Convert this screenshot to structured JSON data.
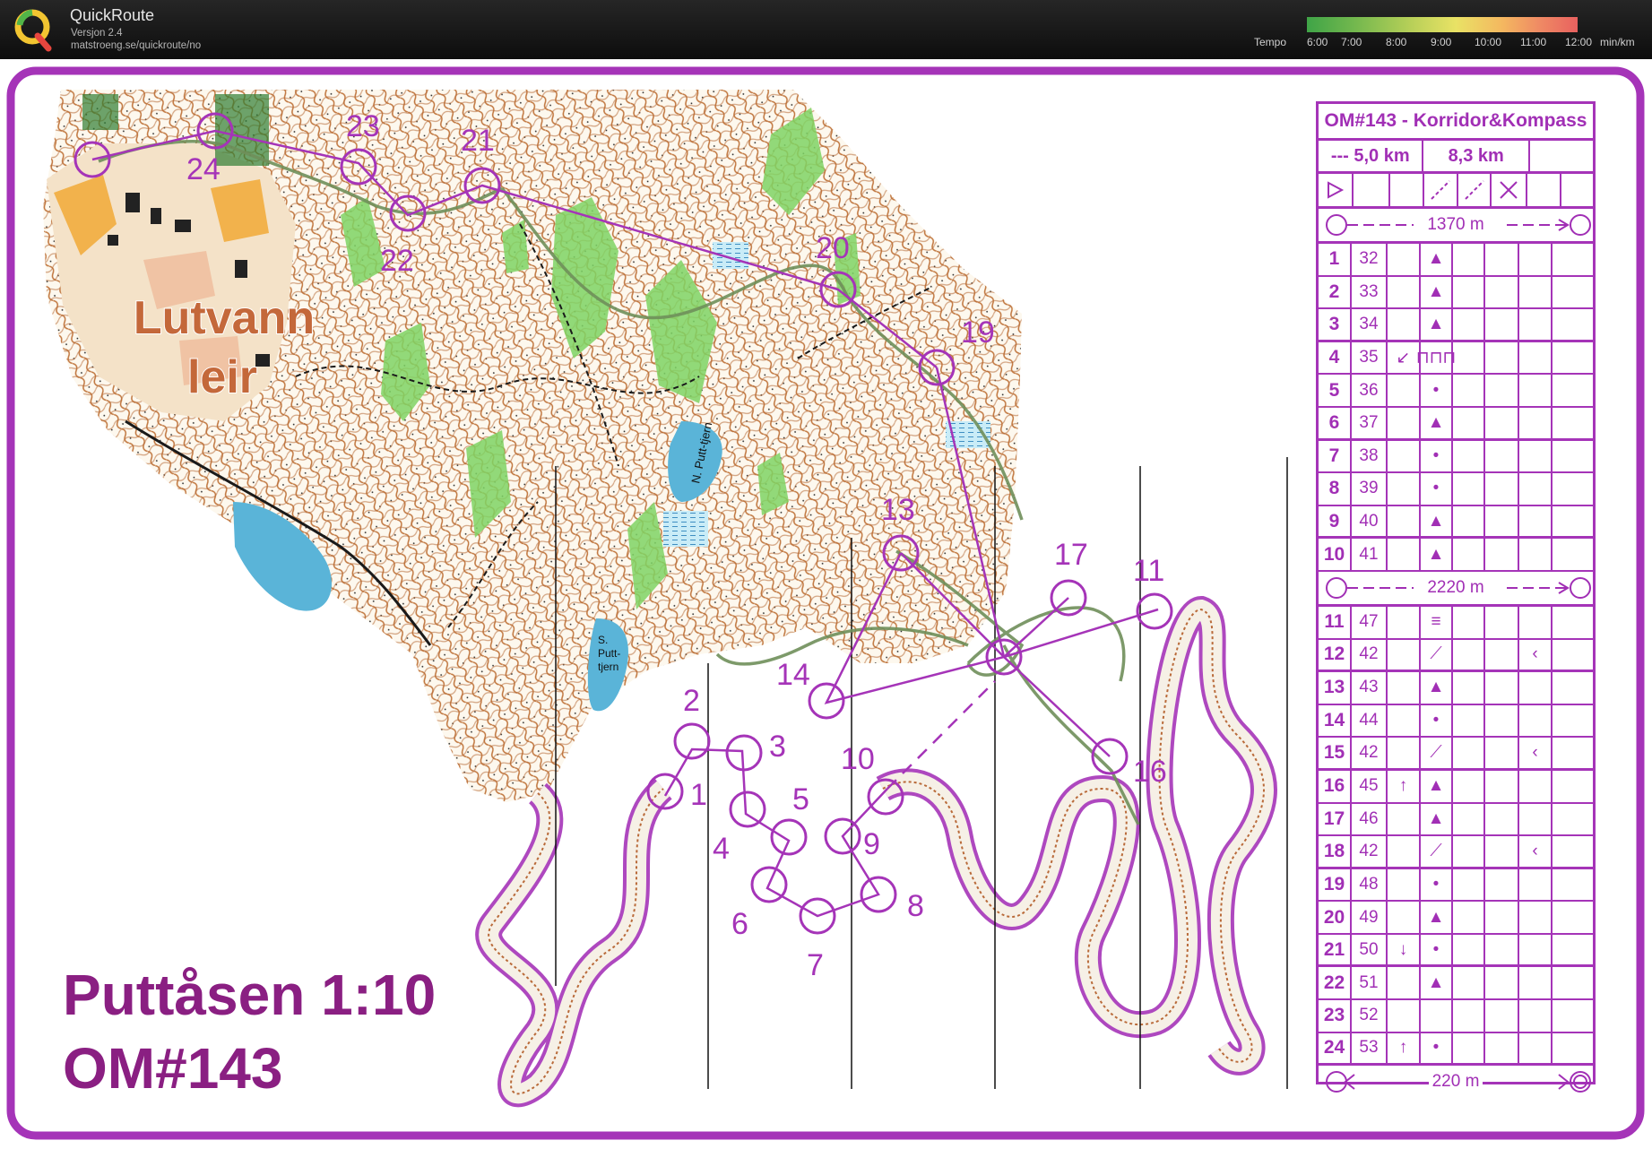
{
  "app": {
    "name": "QuickRoute",
    "version": "Versjon 2.4",
    "url": "matstroeng.se/quickroute/no",
    "tempo_label": "Tempo",
    "tempo_ticks": [
      "6:00",
      "7:00",
      "8:00",
      "9:00",
      "10:00",
      "11:00",
      "12:00"
    ],
    "tempo_unit": "min/km"
  },
  "map": {
    "place_name_line1": "Lutvann",
    "place_name_line2": "leir",
    "lake_north": "N. Putt-tjern",
    "lake_south_l1": "S.",
    "lake_south_l2": "Putt-",
    "lake_south_l3": "tjern",
    "map_title_line1": "Puttåsen 1:10",
    "map_title_line2": "OM#143",
    "controls": [
      "1",
      "2",
      "3",
      "4",
      "5",
      "6",
      "7",
      "8",
      "9",
      "10",
      "11",
      "13",
      "14",
      "16",
      "17",
      "19",
      "20",
      "21",
      "22",
      "23",
      "24"
    ]
  },
  "description": {
    "title": "OM#143 - Korridor&Kompass",
    "course": "---",
    "length1": "5,0 km",
    "length2": "8,3 km",
    "leg1": "1370 m",
    "leg2": "2220 m",
    "leg3": "220 m",
    "rows": [
      {
        "num": "1",
        "code": "32",
        "dir": "",
        "feat": "▲",
        "extra": ""
      },
      {
        "num": "2",
        "code": "33",
        "dir": "",
        "feat": "▲",
        "extra": ""
      },
      {
        "num": "3",
        "code": "34",
        "dir": "",
        "feat": "▲",
        "extra": ""
      },
      {
        "num": "4",
        "code": "35",
        "dir": "↙",
        "feat": "⊓⊓⊓",
        "extra": ""
      },
      {
        "num": "5",
        "code": "36",
        "dir": "",
        "feat": "•",
        "extra": ""
      },
      {
        "num": "6",
        "code": "37",
        "dir": "",
        "feat": "▲",
        "extra": ""
      },
      {
        "num": "7",
        "code": "38",
        "dir": "",
        "feat": "•",
        "extra": ""
      },
      {
        "num": "8",
        "code": "39",
        "dir": "",
        "feat": "•",
        "extra": ""
      },
      {
        "num": "9",
        "code": "40",
        "dir": "",
        "feat": "▲",
        "extra": ""
      },
      {
        "num": "10",
        "code": "41",
        "dir": "",
        "feat": "▲",
        "extra": ""
      },
      {
        "num": "11",
        "code": "47",
        "dir": "",
        "feat": "≡",
        "extra": ""
      },
      {
        "num": "12",
        "code": "42",
        "dir": "",
        "feat": "⟋",
        "extra": "‹"
      },
      {
        "num": "13",
        "code": "43",
        "dir": "",
        "feat": "▲",
        "extra": ""
      },
      {
        "num": "14",
        "code": "44",
        "dir": "",
        "feat": "•",
        "extra": ""
      },
      {
        "num": "15",
        "code": "42",
        "dir": "",
        "feat": "⟋",
        "extra": "‹"
      },
      {
        "num": "16",
        "code": "45",
        "dir": "↑",
        "feat": "▲",
        "extra": ""
      },
      {
        "num": "17",
        "code": "46",
        "dir": "",
        "feat": "▲",
        "extra": ""
      },
      {
        "num": "18",
        "code": "42",
        "dir": "",
        "feat": "⟋",
        "extra": "‹"
      },
      {
        "num": "19",
        "code": "48",
        "dir": "",
        "feat": "•",
        "extra": ""
      },
      {
        "num": "20",
        "code": "49",
        "dir": "",
        "feat": "▲",
        "extra": ""
      },
      {
        "num": "21",
        "code": "50",
        "dir": "↓",
        "feat": "•",
        "extra": ""
      },
      {
        "num": "22",
        "code": "51",
        "dir": "",
        "feat": "▲",
        "extra": ""
      },
      {
        "num": "23",
        "code": "52",
        "dir": "",
        "feat": "",
        "extra": ""
      },
      {
        "num": "24",
        "code": "53",
        "dir": "↑",
        "feat": "•",
        "extra": ""
      }
    ]
  },
  "colors": {
    "purple": "#a534b8",
    "brown": "#b4643c",
    "green": "#6fcf5a",
    "water": "#5ab4d8",
    "road_yellow": "#f2b24c"
  }
}
